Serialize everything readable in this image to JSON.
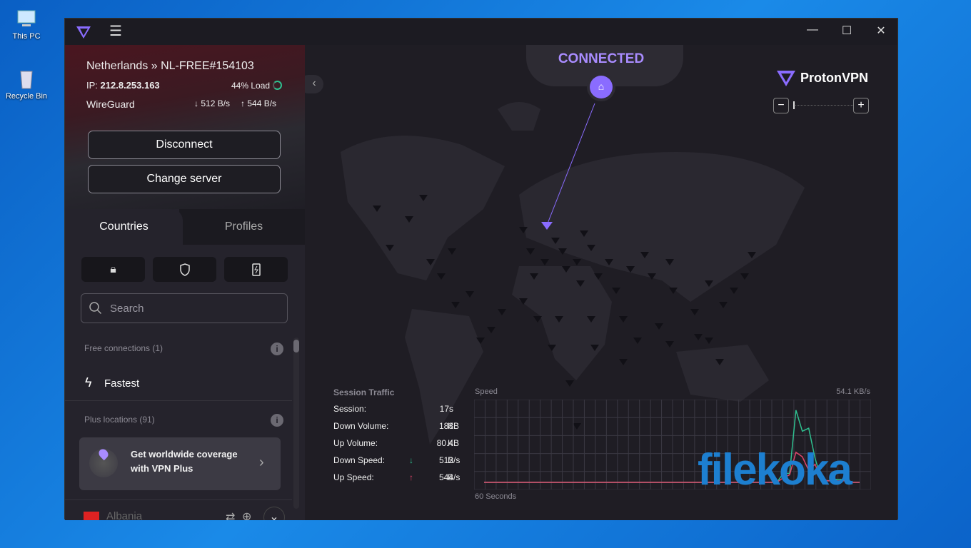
{
  "desktop": {
    "icons": [
      {
        "label": "This PC"
      },
      {
        "label": "Recycle Bin"
      }
    ]
  },
  "window": {
    "controls": [
      "minimize",
      "maximize",
      "close"
    ]
  },
  "connection": {
    "location": "Netherlands » NL-FREE#154103",
    "ip_label": "IP:",
    "ip": "212.8.253.163",
    "load": "44% Load",
    "load_percent": 44,
    "protocol": "WireGuard",
    "down": "512 B/s",
    "up": "544 B/s",
    "disconnect": "Disconnect",
    "change_server": "Change server"
  },
  "tabs": [
    {
      "label": "Countries",
      "active": true
    },
    {
      "label": "Profiles",
      "active": false
    }
  ],
  "filters": [
    "lock-icon",
    "shield-icon",
    "p2p-icon"
  ],
  "search": {
    "placeholder": "Search",
    "value": ""
  },
  "list": {
    "free_header": "Free connections (1)",
    "fastest": "Fastest",
    "plus_header": "Plus locations (91)",
    "upsell": "Get worldwide coverage with VPN Plus",
    "partial_country": "Albania"
  },
  "map": {
    "status": "CONNECTED",
    "brand": "ProtonVPN",
    "accent": "#8a6cff"
  },
  "traffic": {
    "title": "Session Traffic",
    "rows": [
      {
        "label": "Session:",
        "value": "17s",
        "unit": ""
      },
      {
        "label": "Down Volume:",
        "value": "183",
        "unit": "KB"
      },
      {
        "label": "Up Volume:",
        "value": "80.4",
        "unit": "KB"
      },
      {
        "label": "Down Speed:",
        "value": "512",
        "unit": "B/s",
        "arrow": "↓"
      },
      {
        "label": "Up Speed:",
        "value": "544",
        "unit": "B/s",
        "arrow": "↑"
      }
    ]
  },
  "chart_data": {
    "type": "line",
    "title": "Speed",
    "xlabel": "60 Seconds",
    "ymax_label": "54.1 KB/s",
    "ylim": [
      0,
      54.1
    ],
    "grid": true,
    "series": [
      {
        "color": "#2fbf8f",
        "values": [
          0,
          0,
          0,
          0,
          0,
          0,
          0,
          0,
          0,
          0,
          0,
          0,
          0,
          0,
          0,
          0,
          0,
          0,
          0,
          0,
          0,
          0,
          0,
          0,
          0,
          0,
          0,
          0,
          0,
          0,
          0,
          0,
          0,
          0,
          0,
          0,
          0,
          0,
          0,
          0,
          0,
          0,
          0,
          0,
          0,
          0,
          0,
          6,
          6,
          48,
          34,
          36,
          16,
          2,
          1,
          2,
          2,
          1,
          0,
          0
        ]
      },
      {
        "color": "#e0456a",
        "values": [
          0,
          0,
          0,
          0,
          0,
          0,
          0,
          0,
          0,
          0,
          0,
          0,
          0,
          0,
          0,
          0,
          0,
          0,
          0,
          0,
          0,
          0,
          0,
          0,
          0,
          0,
          0,
          0,
          0,
          0,
          0,
          0,
          0,
          0,
          0,
          0,
          0,
          0,
          0,
          0,
          0,
          0,
          0,
          0,
          0,
          0,
          0,
          3,
          5,
          20,
          17,
          8,
          12,
          2,
          1,
          1,
          1,
          1,
          0,
          0
        ]
      }
    ]
  },
  "watermark": "filekoka"
}
